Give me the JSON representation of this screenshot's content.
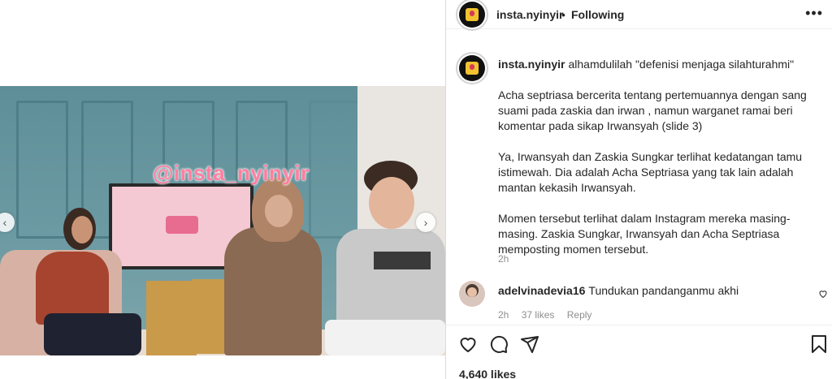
{
  "post": {
    "watermark": "@insta_nyinyir",
    "nav_prev": "‹",
    "nav_next": "›"
  },
  "header": {
    "username": "insta.nyinyir",
    "separator": "•",
    "following_label": "Following",
    "more_label": "•••"
  },
  "caption": {
    "username": "insta.nyinyir",
    "first_line": "alhamdulilah \"defenisi menjaga silahturahmi\"",
    "paragraphs": [
      "Acha septriasa bercerita tentang pertemuannya dengan sang suami pada zaskia dan irwan , namun warganet ramai beri komentar pada sikap Irwansyah (slide 3)",
      "Ya, Irwansyah dan Zaskia Sungkar terlihat kedatangan tamu istimewah. Dia adalah Acha Septriasa yang tak lain adalah mantan kekasih Irwansyah.",
      "Momen tersebut terlihat dalam Instagram mereka masing-masing. Zaskia Sungkar, Irwansyah dan Acha Septriasa memposting momen tersebut."
    ],
    "time": "2h"
  },
  "comments": [
    {
      "username": "adelvinadevia16",
      "text": "Tundukan pandanganmu akhi",
      "time": "2h",
      "likes": "37 likes",
      "reply_label": "Reply"
    }
  ],
  "actions": {
    "like_icon": "heart-icon",
    "comment_icon": "comment-icon",
    "share_icon": "share-icon",
    "save_icon": "bookmark-icon"
  },
  "likes_count": "4,640 likes"
}
